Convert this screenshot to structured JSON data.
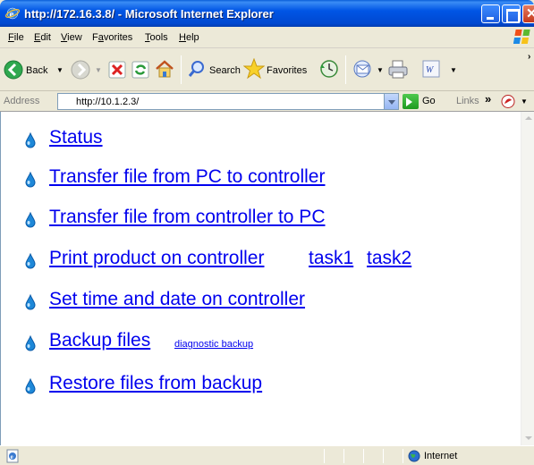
{
  "window": {
    "title": "http://172.16.3.8/ - Microsoft Internet Explorer"
  },
  "menu": [
    {
      "pre": "",
      "acc": "F",
      "post": "ile"
    },
    {
      "pre": "",
      "acc": "E",
      "post": "dit"
    },
    {
      "pre": "",
      "acc": "V",
      "post": "iew"
    },
    {
      "pre": "F",
      "acc": "a",
      "post": "vorites"
    },
    {
      "pre": "",
      "acc": "T",
      "post": "ools"
    },
    {
      "pre": "",
      "acc": "H",
      "post": "elp"
    }
  ],
  "toolbar": {
    "back_label": "Back",
    "search_label": "Search",
    "favorites_label": "Favorites"
  },
  "address": {
    "label": "Address",
    "url": "http://10.1.2.3/",
    "go_label": "Go",
    "links_label": "Links"
  },
  "nav": {
    "status": "Status",
    "pc_to_controller": "Transfer file from PC to controller",
    "controller_to_pc": "Transfer file from controller to PC",
    "print_product": "Print product on controller",
    "task1": "task1",
    "task2": "task2",
    "set_time": "Set time and date on controller",
    "backup": "Backup files",
    "diagnostic_backup": "diagnostic backup",
    "restore": "Restore files from backup"
  },
  "statusbar": {
    "zone": "Internet"
  },
  "colors": {
    "link": "#0000ee",
    "titlebar": "#0055e5",
    "bullet": "#1e88d8"
  }
}
